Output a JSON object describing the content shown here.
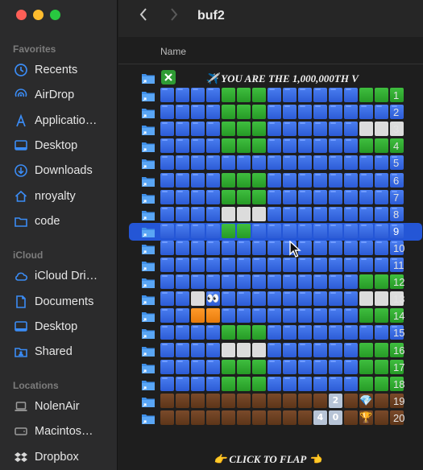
{
  "window": {
    "title": "buf2"
  },
  "list": {
    "column_name": "Name"
  },
  "sidebar": {
    "favorites_title": "Favorites",
    "favorites": [
      {
        "label": "Recents",
        "icon": "clock-icon"
      },
      {
        "label": "AirDrop",
        "icon": "airdrop-icon"
      },
      {
        "label": "Applicatio…",
        "icon": "applications-icon"
      },
      {
        "label": "Desktop",
        "icon": "desktop-icon"
      },
      {
        "label": "Downloads",
        "icon": "downloads-icon"
      },
      {
        "label": "nroyalty",
        "icon": "home-icon"
      },
      {
        "label": "code",
        "icon": "folder-icon"
      }
    ],
    "icloud_title": "iCloud",
    "icloud": [
      {
        "label": "iCloud Dri…",
        "icon": "cloud-icon"
      },
      {
        "label": "Documents",
        "icon": "document-icon"
      },
      {
        "label": "Desktop",
        "icon": "desktop-icon"
      },
      {
        "label": "Shared",
        "icon": "shared-folder-icon"
      }
    ],
    "locations_title": "Locations",
    "locations": [
      {
        "label": "NolenAir",
        "icon": "laptop-icon"
      },
      {
        "label": "Macintos…",
        "icon": "disk-icon"
      },
      {
        "label": "Dropbox",
        "icon": "dropbox-icon"
      }
    ]
  },
  "header_row": {
    "close_icon": "x-checkbox-icon",
    "text": "✈️ YOU ARE THE 1,000,000TH V"
  },
  "rows": [
    {
      "n": "1",
      "cells": "bbbbgggbbbbbbggg"
    },
    {
      "n": "2",
      "cells": "bbbbgggbbbbbbbbb"
    },
    {
      "n": "3",
      "cells": "bbbbgggbbbbbbwww"
    },
    {
      "n": "4",
      "cells": "bbbbgggbbbbbbggg"
    },
    {
      "n": "5",
      "cells": "bbbbbbbbbbbbbbbb"
    },
    {
      "n": "6",
      "cells": "bbbbgggbbbbbbbbb"
    },
    {
      "n": "7",
      "cells": "bbbbgggbbbbbbbbb"
    },
    {
      "n": "8",
      "cells": "bbbbwwwbbbbbbbbb"
    },
    {
      "n": "9",
      "cells": "bbbbggbbbbbbbbbb",
      "selected": true
    },
    {
      "n": "10",
      "cells": "bbbbbbbbbbbbbbbb"
    },
    {
      "n": "11",
      "cells": "bbbbbbbbbbbbbbbb"
    },
    {
      "n": "12",
      "cells": "bbbbbbbbbbbbbggg"
    },
    {
      "n": "13",
      "cells": "bbwebbbbbbbbbwww"
    },
    {
      "n": "14",
      "cells": "bboobbbbbbbbbggg"
    },
    {
      "n": "15",
      "cells": "bbbbgggbbbbbbbbb"
    },
    {
      "n": "16",
      "cells": "bbbbwwwbbbbbbggg"
    },
    {
      "n": "17",
      "cells": "bbbbgggbbbbbbggg"
    },
    {
      "n": "18",
      "cells": "bbbbgggbbbbbbggg"
    },
    {
      "n": "19",
      "cells": "kkkkkkkkkkk2kdkk",
      "digits": [
        "2"
      ],
      "gem": "💎"
    },
    {
      "n": "20",
      "cells": "kkkkkkkkkk40kdkk",
      "digits": [
        "4",
        "0"
      ],
      "trophy": "🏆"
    }
  ],
  "footer": {
    "text": "👉 CLICK TO FLAP 👈"
  },
  "colors": {
    "blue": "#3a6ae6",
    "green": "#2fae2f",
    "white": "#dcdcdc",
    "brown": "#6b3f22",
    "orange": "#f08a18",
    "selection": "#2456d6"
  }
}
